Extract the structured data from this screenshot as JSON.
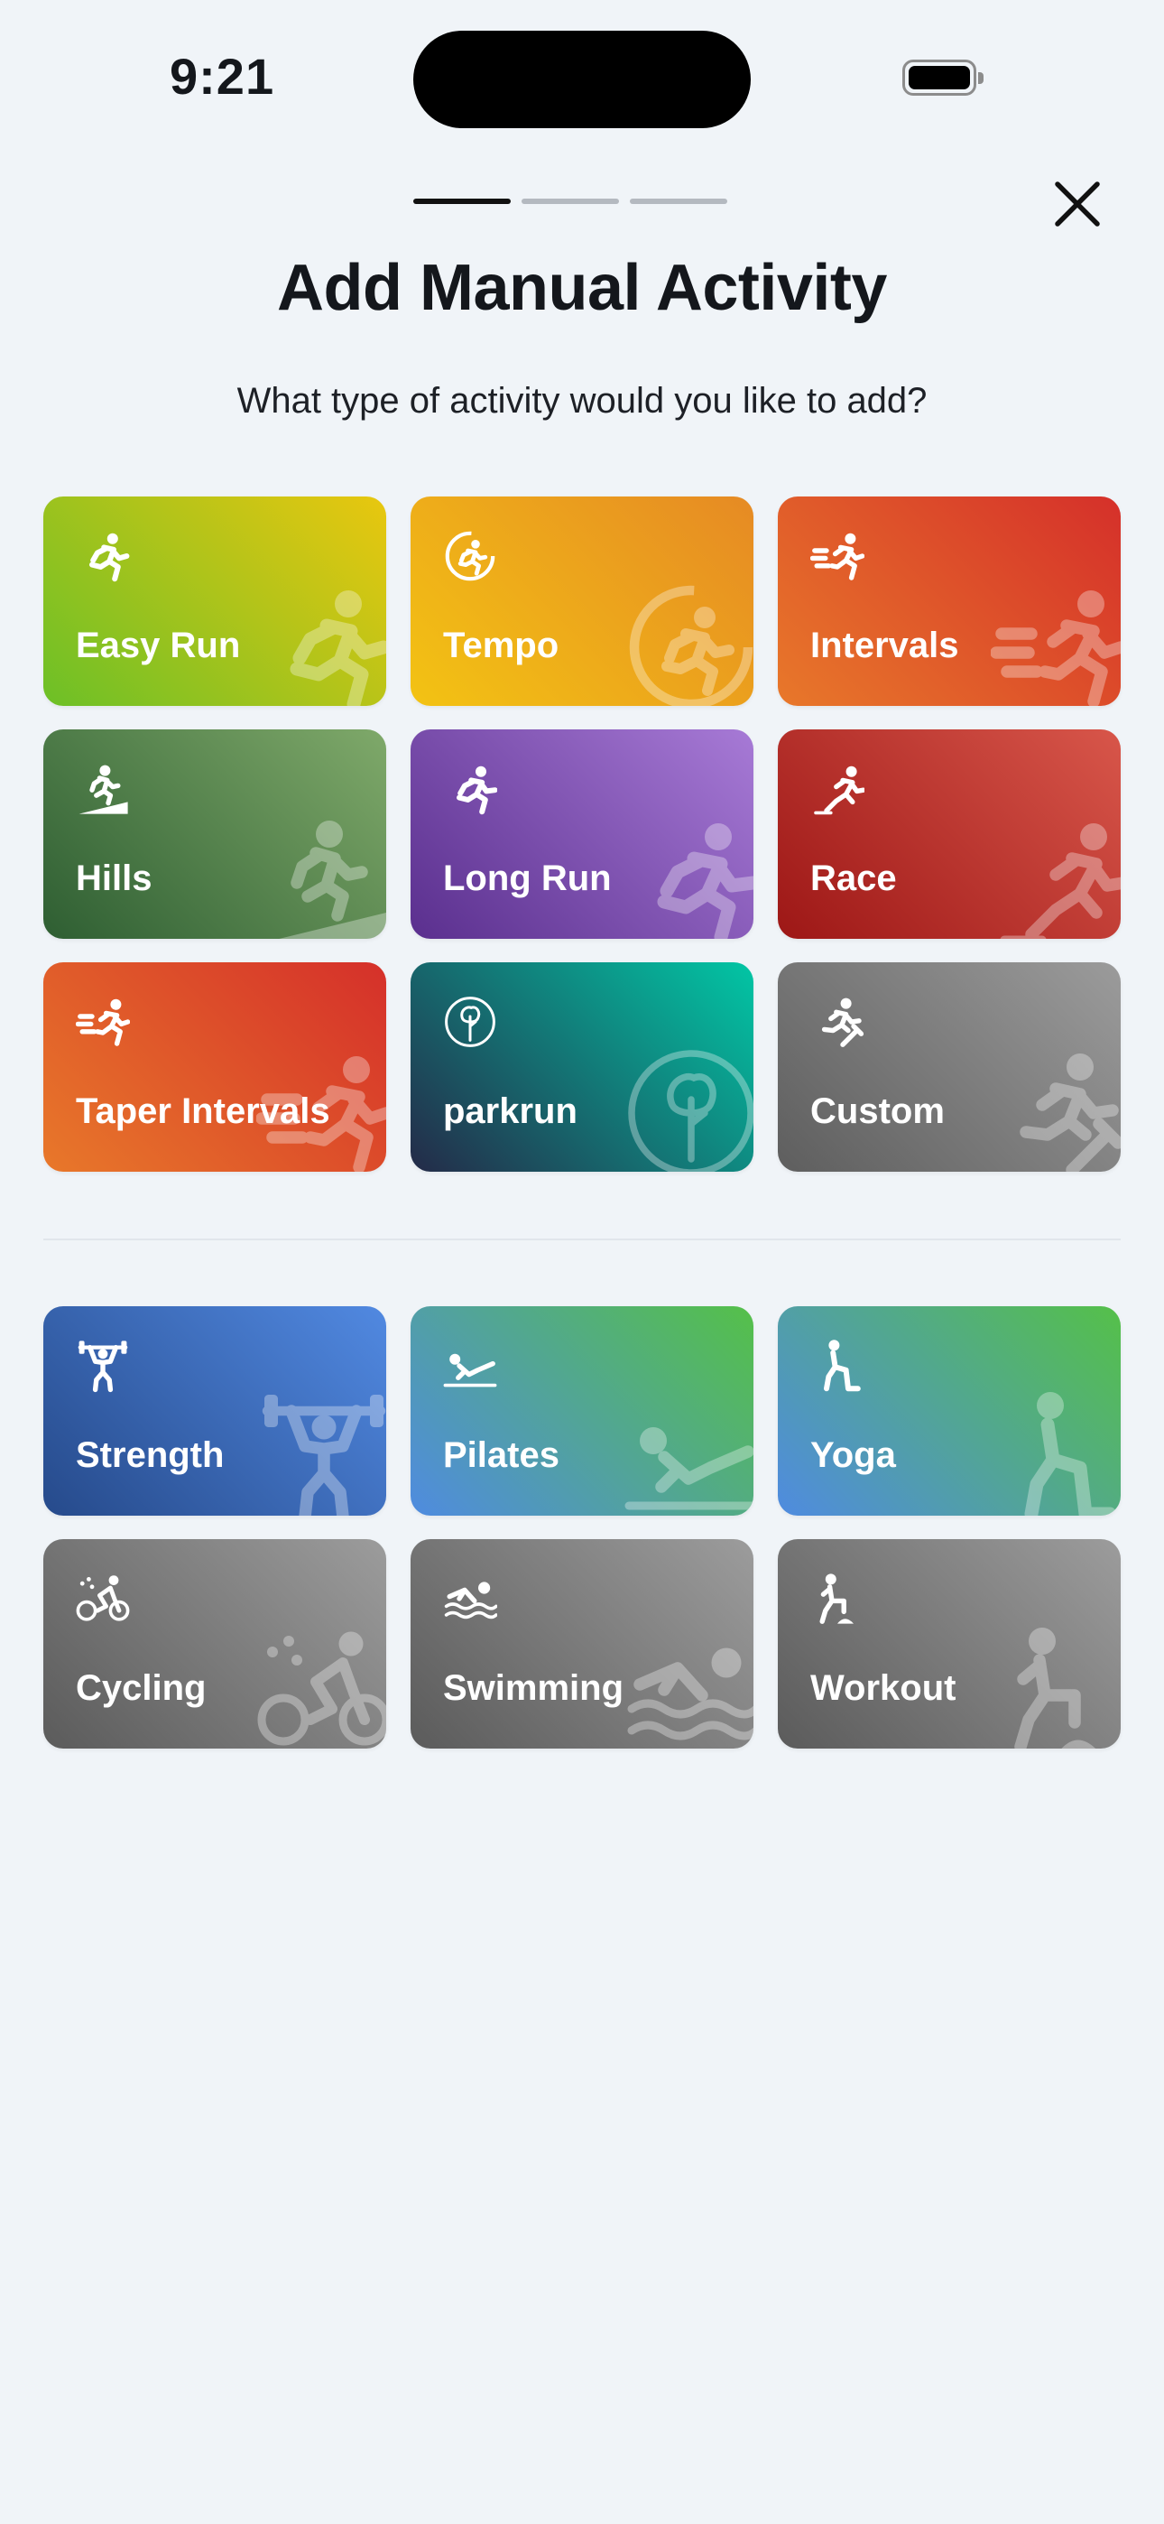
{
  "status_bar": {
    "time": "9:21"
  },
  "header": {
    "progress_steps": 3,
    "active_step": 1,
    "title": "Add Manual Activity",
    "subtitle": "What type of activity would you like to add?"
  },
  "run_activities": [
    {
      "label": "Easy Run",
      "icon": "running-icon",
      "gradient": [
        "#6cc027",
        "#e9c70f"
      ]
    },
    {
      "label": "Tempo",
      "icon": "tempo-runner-icon",
      "gradient": [
        "#f3c313",
        "#e68a24"
      ]
    },
    {
      "label": "Intervals",
      "icon": "sprinting-runner-icon",
      "gradient": [
        "#e8782a",
        "#d5302a"
      ]
    },
    {
      "label": "Hills",
      "icon": "uphill-runner-icon",
      "gradient": [
        "#2e5e32",
        "#7fa96a"
      ]
    },
    {
      "label": "Long Run",
      "icon": "long-run-runner-icon",
      "gradient": [
        "#5a2f8e",
        "#a77ad6"
      ]
    },
    {
      "label": "Race",
      "icon": "race-runner-icon",
      "gradient": [
        "#9d1716",
        "#d8564a"
      ]
    },
    {
      "label": "Taper Intervals",
      "icon": "sprinting-runner-icon",
      "gradient": [
        "#e8782a",
        "#d5302a"
      ]
    },
    {
      "label": "parkrun",
      "icon": "tree-icon",
      "gradient": [
        "#242a48",
        "#02c6a5"
      ]
    },
    {
      "label": "Custom",
      "icon": "runner-wrench-icon",
      "gradient": [
        "#5e5e5e",
        "#9b9b9b"
      ]
    }
  ],
  "other_activities": [
    {
      "label": "Strength",
      "icon": "weightlifting-icon",
      "gradient": [
        "#264a8b",
        "#5189e1"
      ]
    },
    {
      "label": "Pilates",
      "icon": "pilates-icon",
      "gradient": [
        "#4f8be0",
        "#55c049"
      ]
    },
    {
      "label": "Yoga",
      "icon": "yoga-lunge-icon",
      "gradient": [
        "#4f8be0",
        "#55c049"
      ]
    },
    {
      "label": "Cycling",
      "icon": "cycling-icon",
      "gradient": [
        "#5b5b5b",
        "#9c9c9c"
      ]
    },
    {
      "label": "Swimming",
      "icon": "swimming-icon",
      "gradient": [
        "#5b5b5b",
        "#9c9c9c"
      ]
    },
    {
      "label": "Workout",
      "icon": "step-up-workout-icon",
      "gradient": [
        "#5b5b5b",
        "#9c9c9c"
      ]
    }
  ]
}
